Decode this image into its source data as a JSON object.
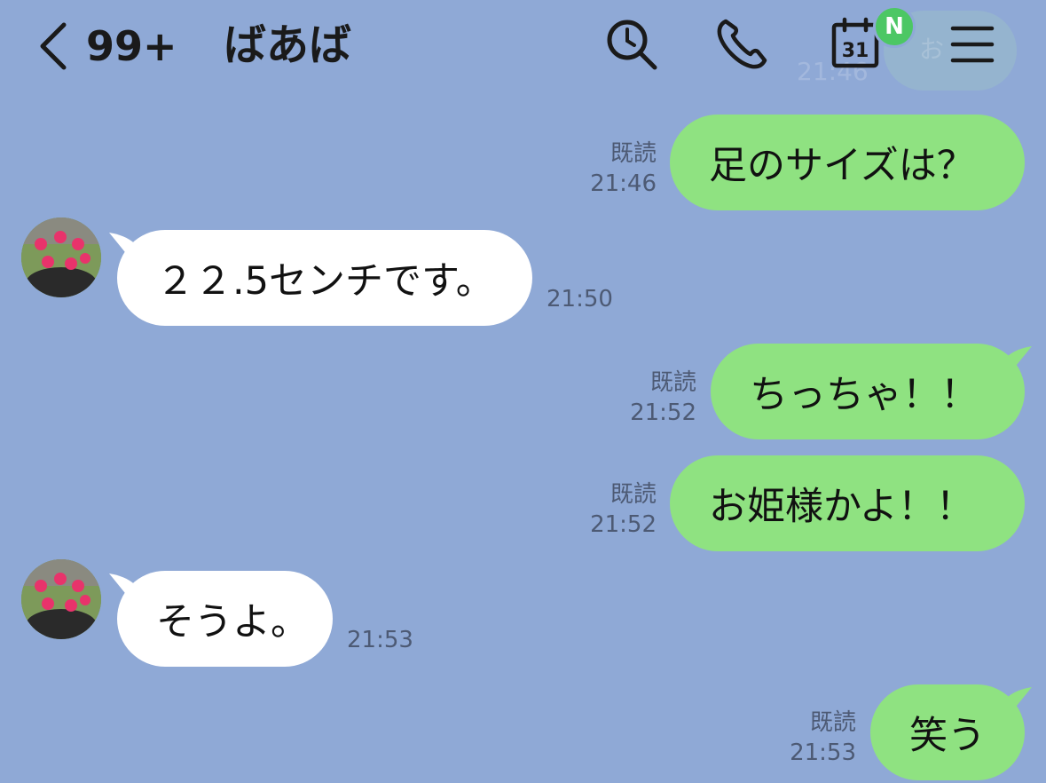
{
  "header": {
    "unread_count": "99+",
    "title": "ばあば",
    "badge": "N",
    "calendar_day": "31",
    "ghost_time": "21:46",
    "ghost_text": "お"
  },
  "messages": [
    {
      "side": "out",
      "text": "足のサイズは？",
      "read": "既読",
      "time": "21:46"
    },
    {
      "side": "in",
      "text": "２２.5センチです。",
      "time": "21:50"
    },
    {
      "side": "out",
      "text": "ちっちゃ！！",
      "read": "既読",
      "time": "21:52"
    },
    {
      "side": "out",
      "text": "お姫様かよ！！",
      "read": "既読",
      "time": "21:52"
    },
    {
      "side": "in",
      "text": "そうよ。",
      "time": "21:53"
    },
    {
      "side": "out",
      "text": "笑う",
      "read": "既読",
      "time": "21:53"
    }
  ],
  "colors": {
    "background": "#8fa9d6",
    "outgoing_bubble": "#8fe281",
    "incoming_bubble": "#ffffff",
    "badge": "#4cc764"
  },
  "icons": [
    "back-chevron-icon",
    "search-icon",
    "phone-icon",
    "calendar-icon",
    "menu-icon"
  ]
}
